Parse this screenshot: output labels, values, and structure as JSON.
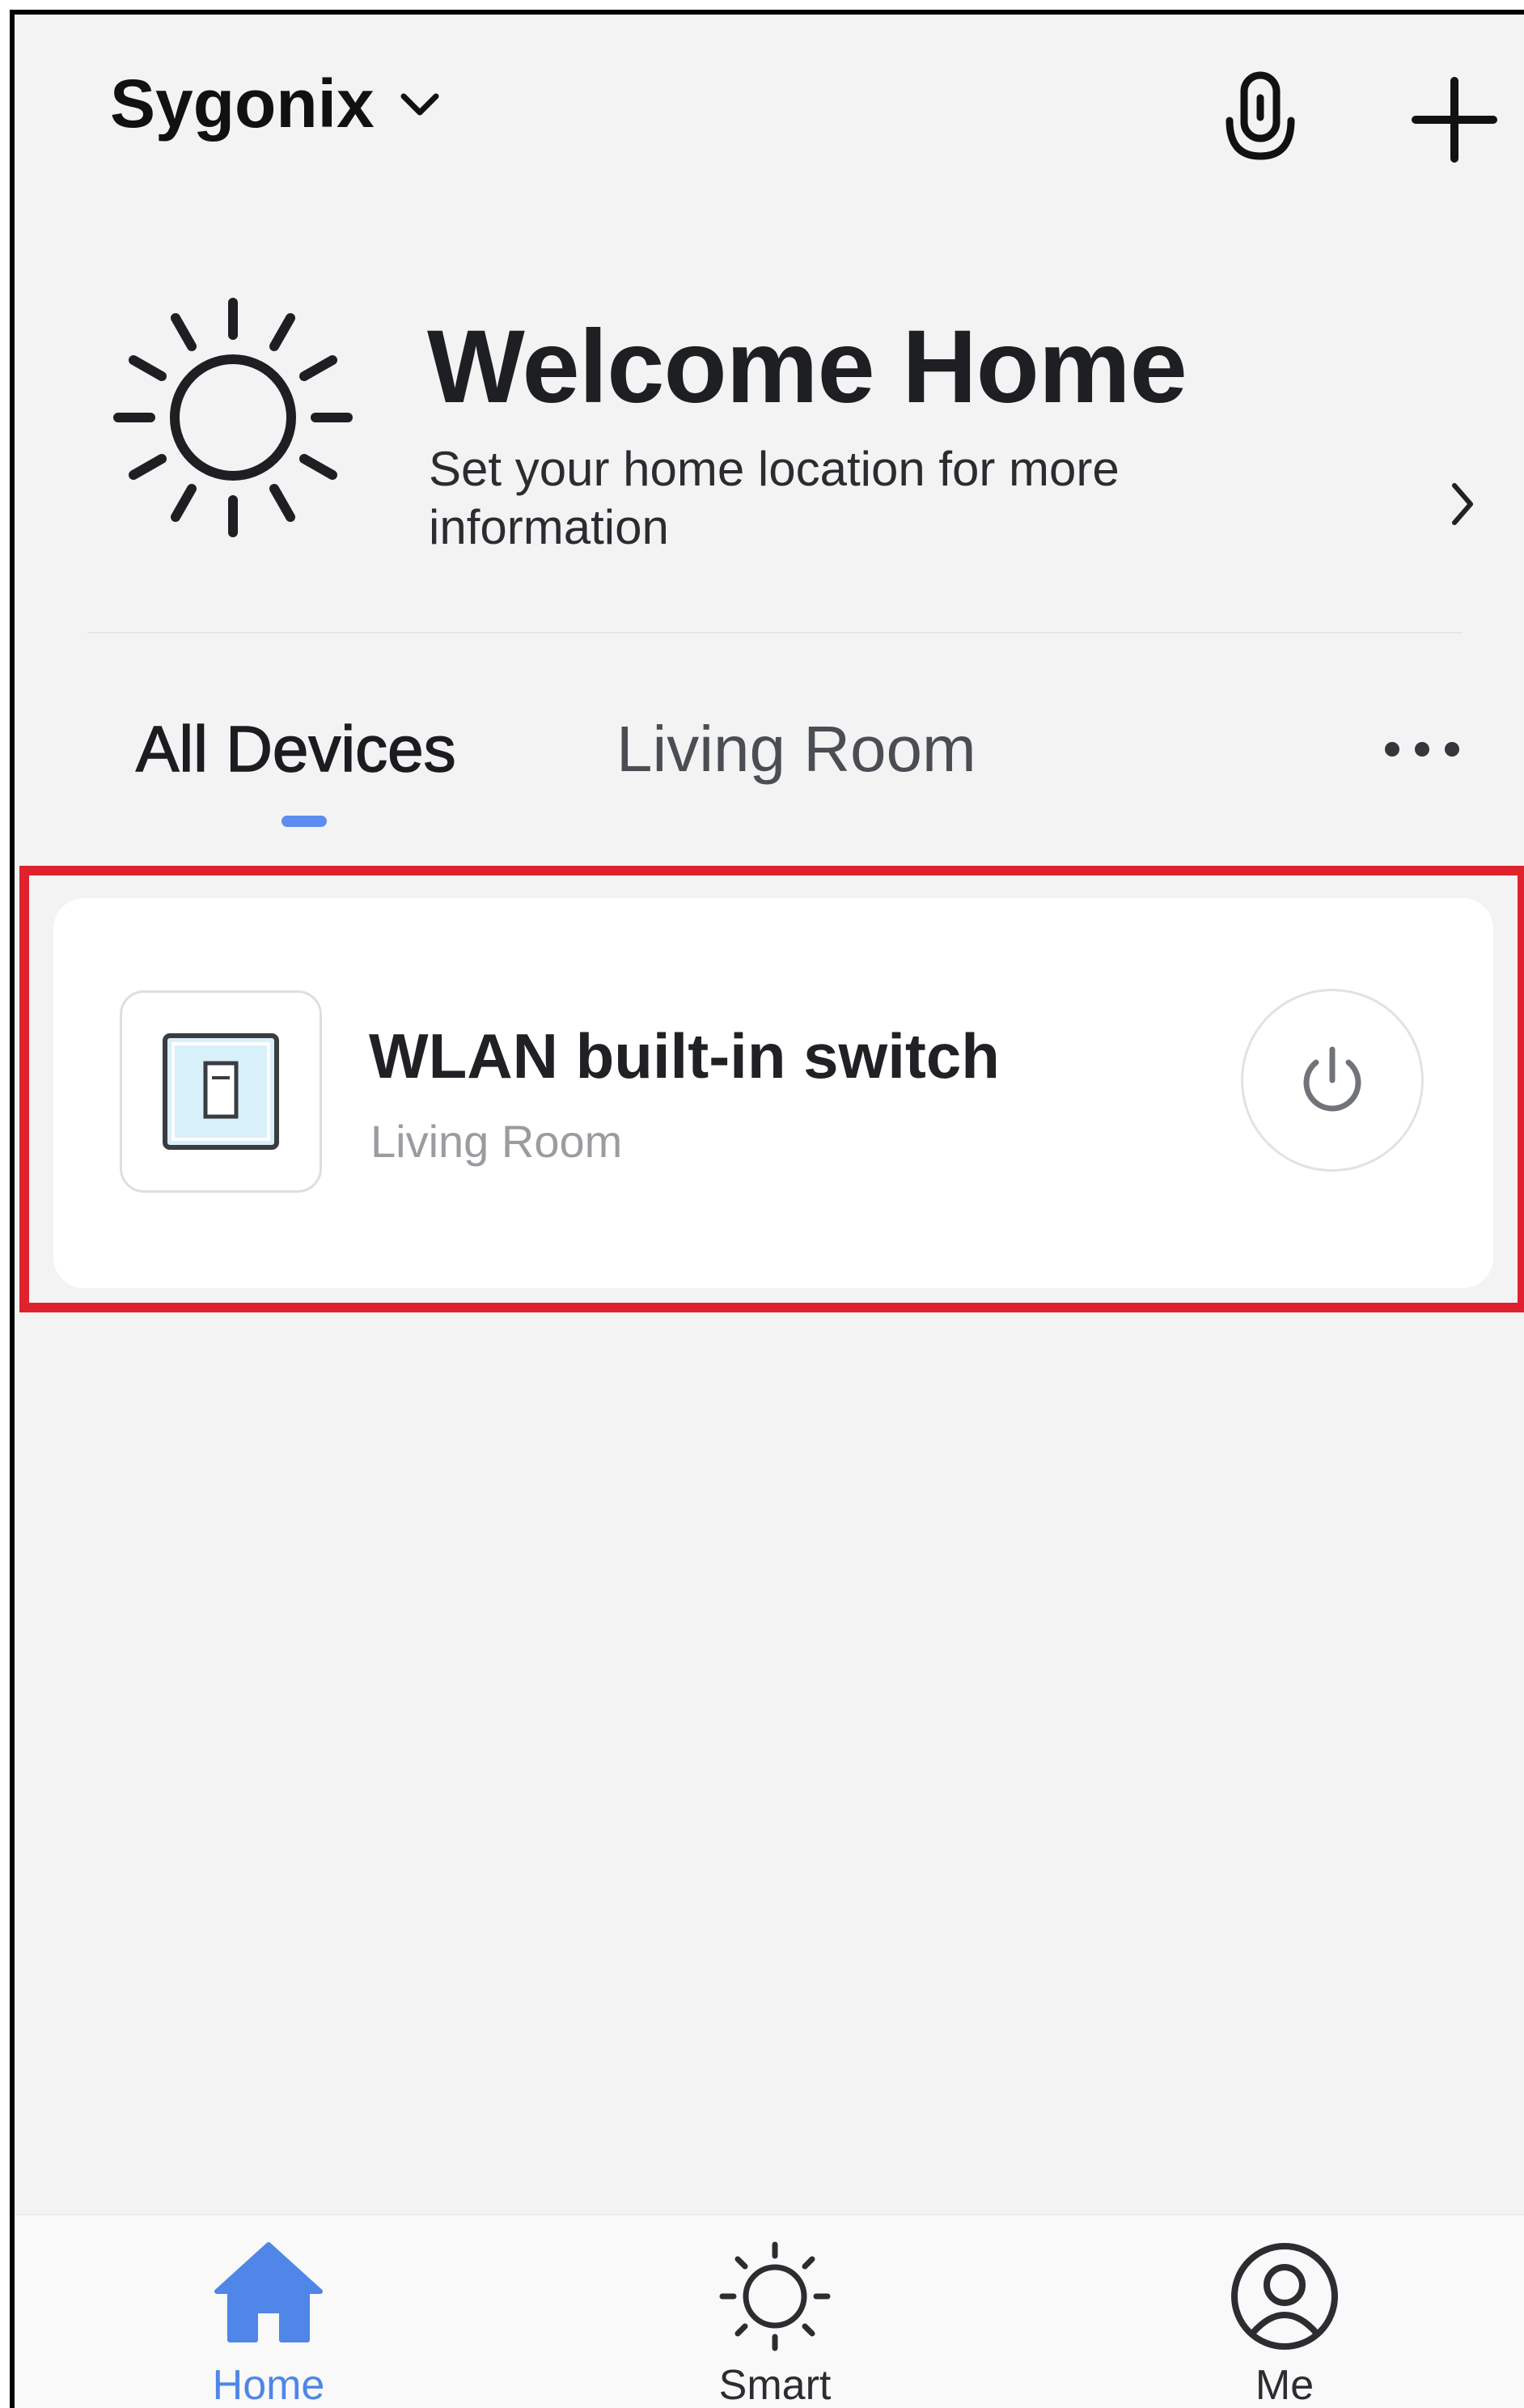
{
  "header": {
    "home_name": "Sygonix",
    "icons": [
      "chevron-down-icon",
      "microphone-icon",
      "plus-icon"
    ]
  },
  "welcome": {
    "title": "Welcome Home",
    "subtitle": "Set your home location for more information",
    "icon": "sun-icon"
  },
  "tabs": {
    "items": [
      {
        "label": "All Devices",
        "active": true
      },
      {
        "label": "Living Room",
        "active": false
      }
    ],
    "more_icon": "more-dots-icon",
    "indicator_color": "#5b8ef0"
  },
  "devices": [
    {
      "name": "WLAN built-in switch",
      "room": "Living Room",
      "icon": "wall-switch-icon",
      "power_icon": "power-icon"
    }
  ],
  "highlight_color": "#e0222e",
  "bottom_nav": {
    "items": [
      {
        "label": "Home",
        "icon": "home-icon",
        "active": true
      },
      {
        "label": "Smart",
        "icon": "smart-sun-icon",
        "active": false
      },
      {
        "label": "Me",
        "icon": "user-circle-icon",
        "active": false
      }
    ],
    "active_color": "#4f86e8"
  }
}
